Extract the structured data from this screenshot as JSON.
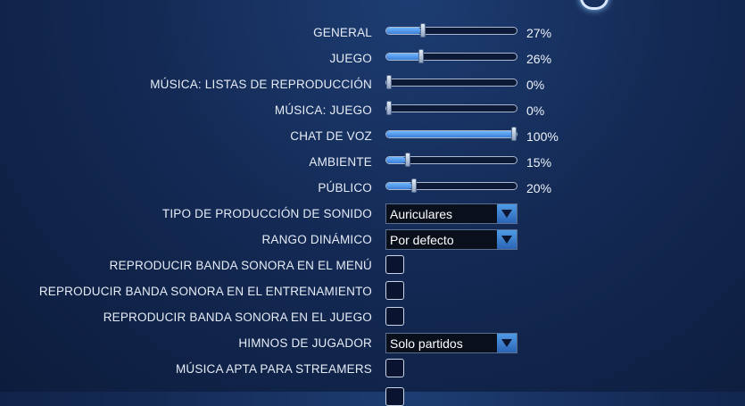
{
  "sliders": [
    {
      "label": "GENERAL",
      "value_text": "27%",
      "value": 27
    },
    {
      "label": "JUEGO",
      "value_text": "26%",
      "value": 26
    },
    {
      "label": "MÚSICA: LISTAS DE REPRODUCCIÓN",
      "value_text": "0%",
      "value": 0
    },
    {
      "label": "MÚSICA: JUEGO",
      "value_text": "0%",
      "value": 0
    },
    {
      "label": "CHAT DE VOZ",
      "value_text": "100%",
      "value": 100
    },
    {
      "label": "AMBIENTE",
      "value_text": "15%",
      "value": 15
    },
    {
      "label": "PÚBLICO",
      "value_text": "20%",
      "value": 20
    }
  ],
  "dropdowns": {
    "output_type": {
      "label": "TIPO DE PRODUCCIÓN DE SONIDO",
      "value": "Auriculares"
    },
    "dynamic_range": {
      "label": "RANGO DINÁMICO",
      "value": "Por defecto"
    },
    "player_anthems": {
      "label": "HIMNOS DE JUGADOR",
      "value": "Solo partidos"
    }
  },
  "checkboxes": {
    "menu_soundtrack": {
      "label": "REPRODUCIR BANDA SONORA EN EL MENÚ",
      "checked": false
    },
    "training_soundtrack": {
      "label": "REPRODUCIR BANDA SONORA EN EL ENTRENAMIENTO",
      "checked": false
    },
    "game_soundtrack": {
      "label": "REPRODUCIR BANDA SONORA EN EL JUEGO",
      "checked": false
    },
    "streamer_music": {
      "label": "MÚSICA APTA PARA STREAMERS",
      "checked": false
    }
  },
  "icons": {
    "dropdown_arrow": "triangle-down-icon"
  },
  "colors": {
    "slider_fill": "#4f9be6",
    "background": "#142a55"
  }
}
